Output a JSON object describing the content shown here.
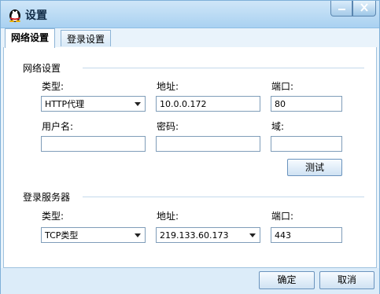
{
  "window": {
    "title": "设置"
  },
  "tabs": [
    {
      "label": "网络设置",
      "active": true
    },
    {
      "label": "登录设置",
      "active": false
    }
  ],
  "network": {
    "section_title": "网络设置",
    "type_label": "类型:",
    "type_value": "HTTP代理",
    "address_label": "地址:",
    "address_value": "10.0.0.172",
    "port_label": "端口:",
    "port_value": "80",
    "username_label": "用户名:",
    "username_value": "",
    "password_label": "密码:",
    "password_value": "",
    "domain_label": "域:",
    "domain_value": "",
    "test_button": "测试"
  },
  "login_server": {
    "section_title": "登录服务器",
    "type_label": "类型:",
    "type_value": "TCP类型",
    "address_label": "地址:",
    "address_value": "219.133.60.173",
    "port_label": "端口:",
    "port_value": "443"
  },
  "footer": {
    "ok_label": "确定",
    "cancel_label": "取消"
  }
}
